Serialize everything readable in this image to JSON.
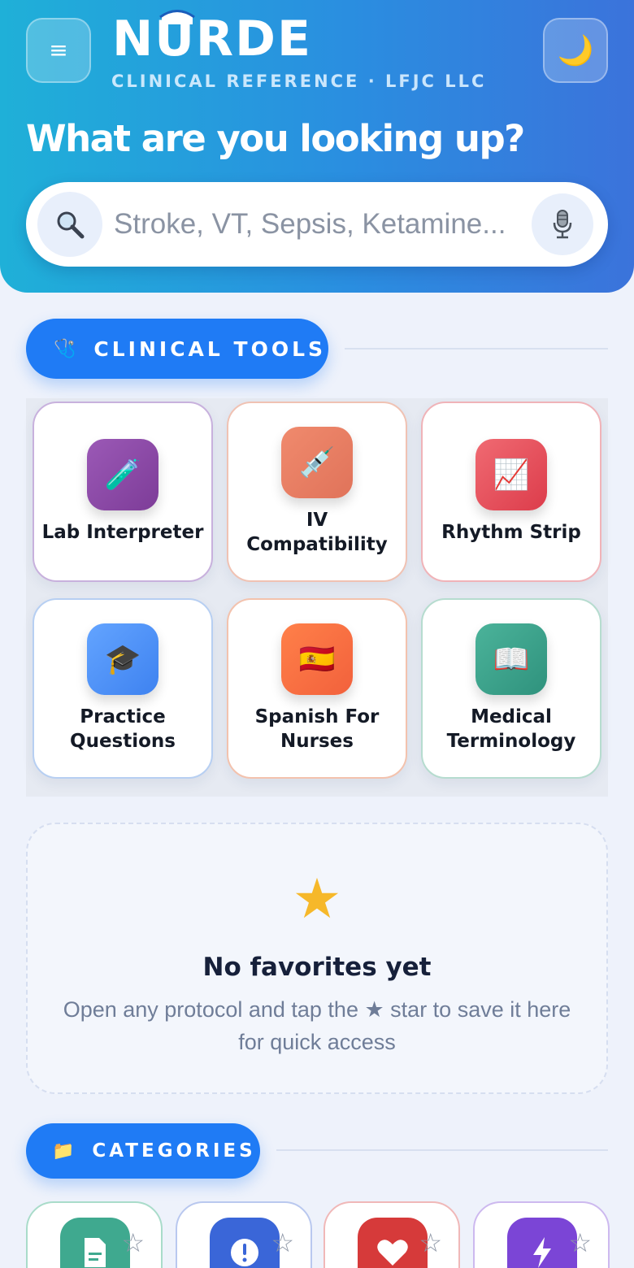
{
  "header": {
    "brand": "NURDE",
    "tagline": "CLINICAL REFERENCE · LFJC LLC",
    "headline": "What are you looking up?",
    "menu_glyph": "≡",
    "theme_glyph": "🌙",
    "search": {
      "placeholder": "Stroke, VT, Sepsis, Ketamine..."
    }
  },
  "tools_section": {
    "label": "CLINICAL TOOLS",
    "icon": "🩺",
    "cards": [
      {
        "label": "Lab Interpreter",
        "icon": "🧪"
      },
      {
        "label": "IV Compatibility",
        "icon": "💉"
      },
      {
        "label": "Rhythm Strip",
        "icon": "📈"
      },
      {
        "label": "Practice Questions",
        "icon": "🎓"
      },
      {
        "label": "Spanish For Nurses",
        "icon": "🇪🇸"
      },
      {
        "label": "Medical Terminology",
        "icon": "📖"
      }
    ]
  },
  "favorites": {
    "star": "★",
    "title": "No favorites yet",
    "text": "Open any protocol and tap the ★ star to save it here for quick access"
  },
  "categories_section": {
    "label": "CATEGORIES",
    "icon": "📁",
    "star_glyph": "☆",
    "items": [
      {
        "icon": "document-icon",
        "color": "#3fa98f"
      },
      {
        "icon": "alert-icon",
        "color": "#3a66d8"
      },
      {
        "icon": "heart-icon",
        "color": "#d63a3a"
      },
      {
        "icon": "bolt-icon",
        "color": "#7b45d6"
      }
    ]
  },
  "colors": {
    "accent": "#1f7bf5",
    "header_start": "#1fb0d8",
    "header_end": "#3b73db"
  }
}
